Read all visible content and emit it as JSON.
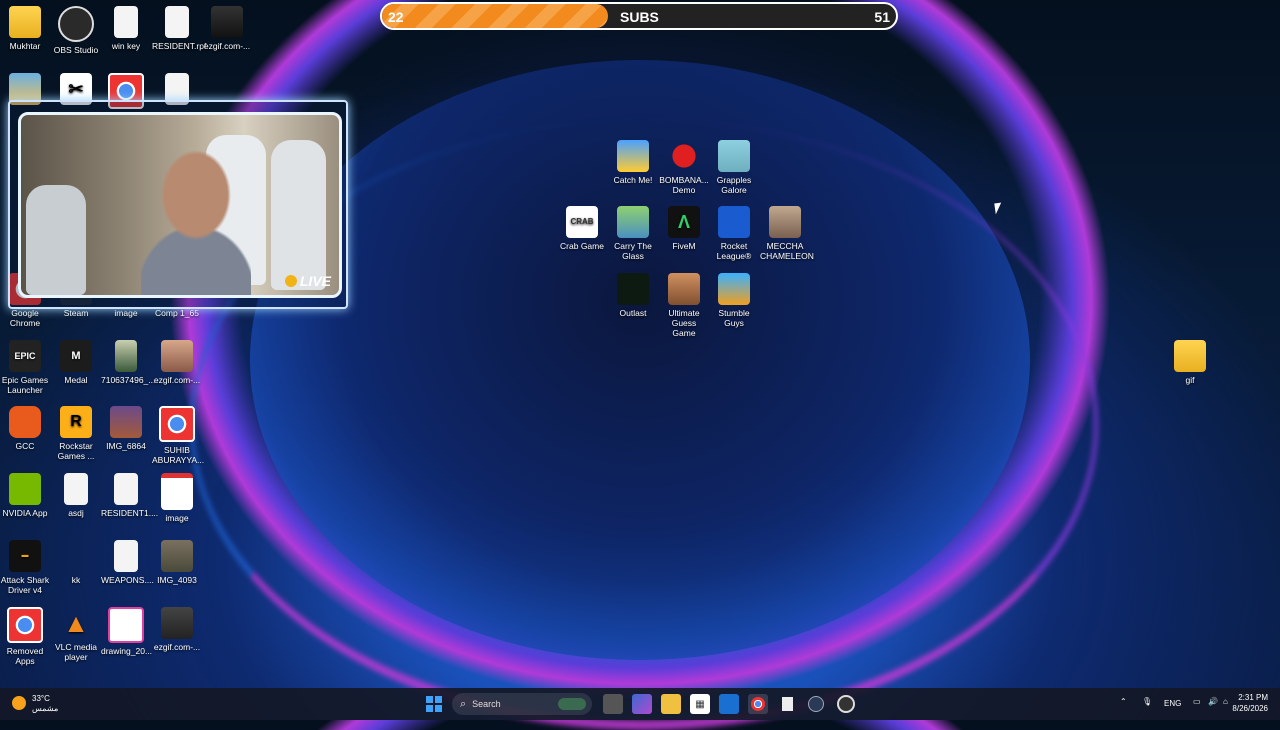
{
  "subs_goal": {
    "current": "22",
    "label": "SUBS",
    "goal": "51",
    "progress": 0.44
  },
  "webcam": {
    "live_label": "LIVE"
  },
  "desktop_icons": {
    "left_col1": [
      {
        "label": "Mukhtar"
      },
      {
        "label": "Google Chrome"
      },
      {
        "label": "Epic Games Launcher"
      },
      {
        "label": "GCC"
      },
      {
        "label": "NVIDIA App"
      },
      {
        "label": "Attack Shark Driver v4"
      },
      {
        "label": "Removed Apps"
      }
    ],
    "left_col2": [
      {
        "label": "OBS Studio"
      },
      {
        "label": "Steam"
      },
      {
        "label": "Medal"
      },
      {
        "label": "Rockstar Games ..."
      },
      {
        "label": "asdj"
      },
      {
        "label": "kk"
      },
      {
        "label": "VLC media player"
      }
    ],
    "left_col3": [
      {
        "label": "win key"
      },
      {
        "label": "image"
      },
      {
        "label": "710637496_..."
      },
      {
        "label": "IMG_6864"
      },
      {
        "label": "RESIDENT1...."
      },
      {
        "label": "WEAPONS...."
      },
      {
        "label": "drawing_20..."
      }
    ],
    "left_col4": [
      {
        "label": "RESIDENT.rpf"
      },
      {
        "label": "Comp 1_65"
      },
      {
        "label": "ezgif.com-..."
      },
      {
        "label": "SUHIB ABURAYYA..."
      },
      {
        "label": "image"
      },
      {
        "label": "IMG_4093"
      },
      {
        "label": "ezgif.com-..."
      }
    ],
    "left_col5": [
      {
        "label": "ezgif.com-..."
      }
    ],
    "center_row1": [
      {
        "label": "Catch Me!"
      },
      {
        "label": "BOMBANA... Demo"
      },
      {
        "label": "Grapples Galore"
      }
    ],
    "center_row2": [
      {
        "label": "Crab Game"
      },
      {
        "label": "Carry The Glass"
      },
      {
        "label": "FiveM"
      },
      {
        "label": "Rocket League®"
      },
      {
        "label": "MECCHA CHAMELEON"
      }
    ],
    "center_row3": [
      {
        "label": "Outlast"
      },
      {
        "label": "Ultimate Guess Game"
      },
      {
        "label": "Stumble Guys"
      }
    ],
    "right": [
      {
        "label": "gif"
      }
    ]
  },
  "taskbar": {
    "weather_temp": "33°C",
    "weather_desc": "مشمس",
    "search_placeholder": "Search",
    "language": "ENG",
    "time": "2:31 PM",
    "date": "8/26/2026"
  },
  "colors": {
    "accent_orange": "#f28a1e",
    "tray_bg": "#141826"
  }
}
